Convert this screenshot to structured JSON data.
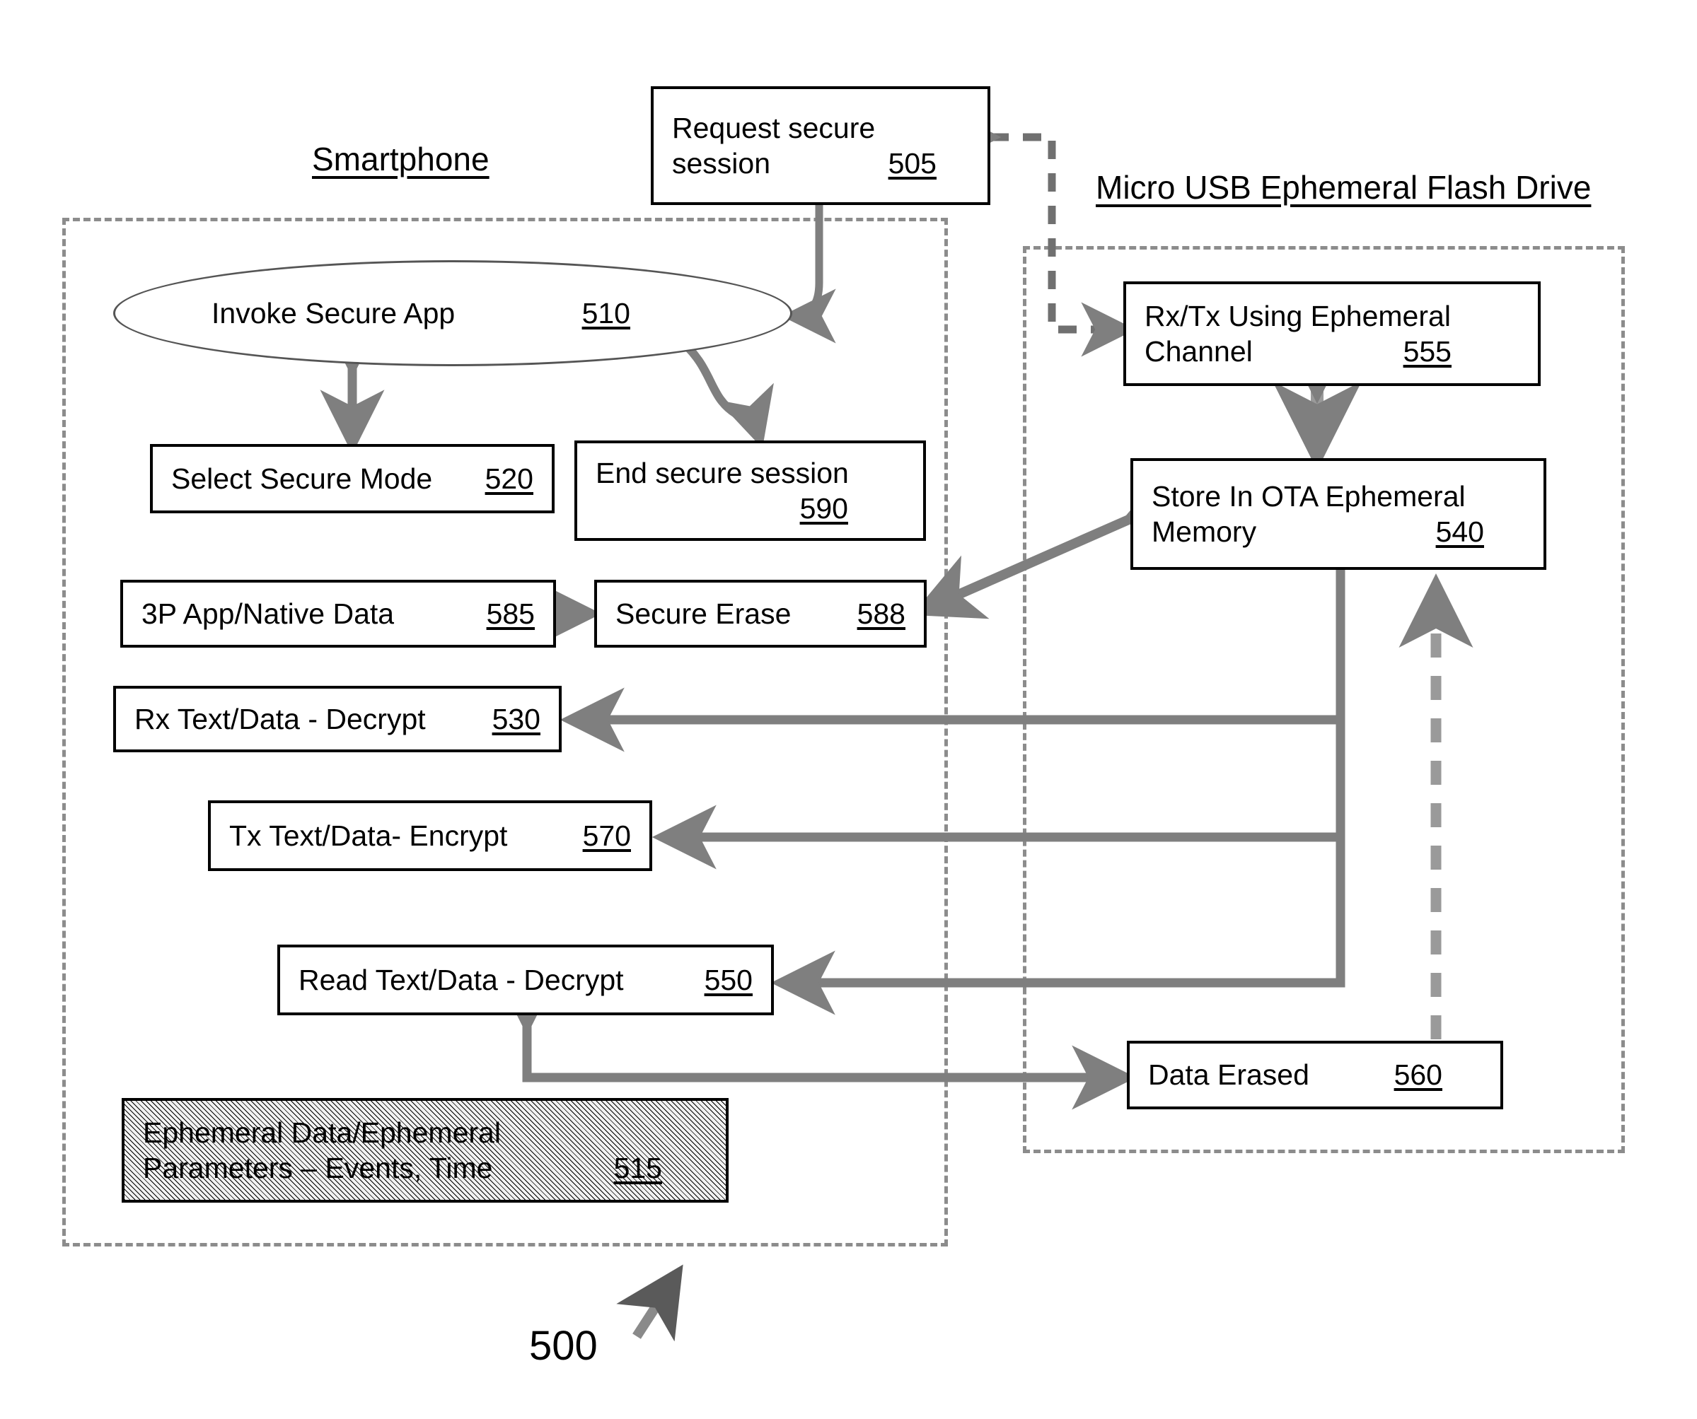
{
  "figure": {
    "number": "500",
    "headers": {
      "left": "Smartphone",
      "right": "Micro USB Ephemeral Flash Drive"
    }
  },
  "colors": {
    "stroke": "#000000",
    "connector": "#7f7f7f",
    "container_border": "#8c8c8c",
    "background": "#ffffff",
    "shaded_fill": "#f2f2f2"
  },
  "nodes": {
    "request_secure_session": {
      "text_line1": "Request secure",
      "text_line2": "session",
      "ref": "505",
      "shape": "rect"
    },
    "invoke_secure_app": {
      "label": "Invoke Secure App",
      "ref": "510",
      "shape": "ellipse"
    },
    "rx_tx_ephemeral": {
      "text_line1": "Rx/Tx Using Ephemeral",
      "text_line2": "Channel",
      "ref": "555",
      "shape": "rect"
    },
    "select_secure_mode": {
      "label": "Select Secure Mode",
      "ref": "520",
      "shape": "rect"
    },
    "end_secure_session": {
      "text_line1": "End secure session",
      "ref": "590",
      "shape": "rect"
    },
    "store_ota_memory": {
      "text_line1": "Store In OTA Ephemeral",
      "text_line2": "Memory",
      "ref": "540",
      "shape": "rect"
    },
    "third_party_data": {
      "label": "3P App/Native Data",
      "ref": "585",
      "shape": "rect"
    },
    "secure_erase": {
      "label": "Secure Erase",
      "ref": "588",
      "shape": "rect"
    },
    "rx_text_decrypt": {
      "label": "Rx Text/Data - Decrypt",
      "ref": "530",
      "shape": "rect"
    },
    "tx_text_encrypt": {
      "label": "Tx Text/Data- Encrypt",
      "ref": "570",
      "shape": "rect"
    },
    "read_text_decrypt": {
      "label": "Read Text/Data - Decrypt",
      "ref": "550",
      "shape": "rect"
    },
    "data_erased": {
      "label": "Data Erased",
      "ref": "560",
      "shape": "rect"
    },
    "ephemeral_parameters": {
      "text_line1": "Ephemeral Data/Ephemeral",
      "text_line2": "Parameters – Events, Time",
      "ref": "515",
      "shape": "rect-shaded"
    }
  },
  "connectors": [
    {
      "name": "request-to-invoke",
      "from": "request_secure_session",
      "to": "invoke_secure_app",
      "style": "solid",
      "arrow": "end"
    },
    {
      "name": "request-to-rxtx",
      "from": "request_secure_session",
      "to": "rx_tx_ephemeral",
      "style": "dotted",
      "arrow": "both"
    },
    {
      "name": "invoke-to-select-mode",
      "from": "invoke_secure_app",
      "to": "select_secure_mode",
      "style": "solid",
      "arrow": "both"
    },
    {
      "name": "invoke-to-end-session",
      "from": "invoke_secure_app",
      "to": "end_secure_session",
      "style": "solid",
      "arrow": "end"
    },
    {
      "name": "rxtx-to-store",
      "from": "rx_tx_ephemeral",
      "to": "store_ota_memory",
      "style": "solid",
      "arrow": "both"
    },
    {
      "name": "third-party-to-erase",
      "from": "third_party_data",
      "to": "secure_erase",
      "style": "solid",
      "arrow": "end"
    },
    {
      "name": "store-to-secure-erase",
      "from": "store_ota_memory",
      "to": "secure_erase",
      "style": "solid",
      "arrow": "both"
    },
    {
      "name": "store-to-rx-decrypt",
      "from": "store_ota_memory",
      "to": "rx_text_decrypt",
      "style": "solid",
      "arrow": "end"
    },
    {
      "name": "store-to-tx-encrypt",
      "from": "store_ota_memory",
      "to": "tx_text_encrypt",
      "style": "solid",
      "arrow": "end"
    },
    {
      "name": "store-to-read-decrypt",
      "from": "store_ota_memory",
      "to": "read_text_decrypt",
      "style": "solid",
      "arrow": "end"
    },
    {
      "name": "read-decrypt-to-erased",
      "from": "read_text_decrypt",
      "to": "data_erased",
      "style": "solid",
      "arrow": "both"
    },
    {
      "name": "data-erased-to-store",
      "from": "data_erased",
      "to": "store_ota_memory",
      "style": "dashed",
      "arrow": "end"
    }
  ]
}
